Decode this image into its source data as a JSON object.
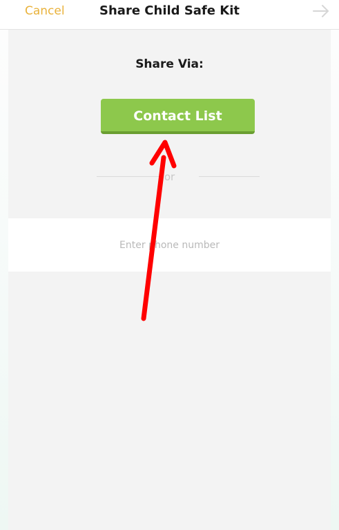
{
  "header": {
    "cancel_label": "Cancel",
    "title": "Share Child Safe Kit",
    "next_icon": "arrow-right-icon"
  },
  "share": {
    "heading": "Share Via:",
    "contact_button_label": "Contact List",
    "divider_text": "or"
  },
  "phone": {
    "placeholder": "Enter phone number",
    "value": ""
  },
  "annotation": {
    "icon": "red-arrow-annotation",
    "color": "#ff0000"
  },
  "colors": {
    "cancel": "#e9b23b",
    "button_green": "#8dc84c",
    "button_shadow": "#6a9e31"
  }
}
